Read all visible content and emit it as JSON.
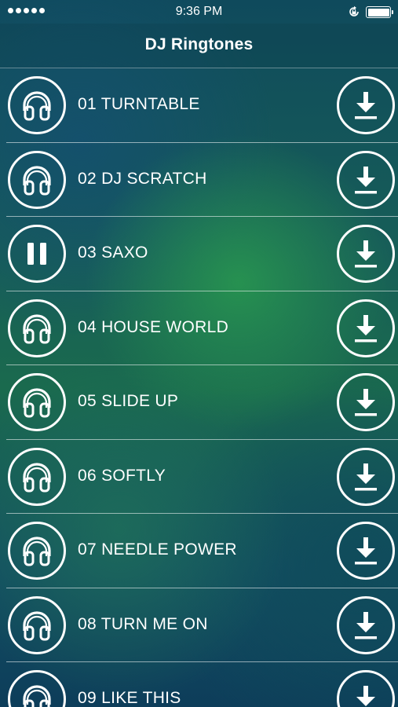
{
  "status_bar": {
    "time": "9:36 PM",
    "signal_dots": 5
  },
  "nav": {
    "title": "DJ Ringtones"
  },
  "tracks": [
    {
      "label": "01 TURNTABLE",
      "state": "headphones-icon"
    },
    {
      "label": "02 DJ SCRATCH",
      "state": "headphones-icon"
    },
    {
      "label": "03 SAXO",
      "state": "pause-icon"
    },
    {
      "label": "04 HOUSE WORLD",
      "state": "headphones-icon"
    },
    {
      "label": "05 SLIDE UP",
      "state": "headphones-icon"
    },
    {
      "label": "06 SOFTLY",
      "state": "headphones-icon"
    },
    {
      "label": "07 NEEDLE POWER",
      "state": "headphones-icon"
    },
    {
      "label": "08 TURN ME ON",
      "state": "headphones-icon"
    },
    {
      "label": "09 LIKE THIS",
      "state": "headphones-icon"
    }
  ],
  "colors": {
    "foreground": "#ffffff",
    "background_top": "#0f4a5c",
    "background_mid": "#1a6a4e"
  }
}
